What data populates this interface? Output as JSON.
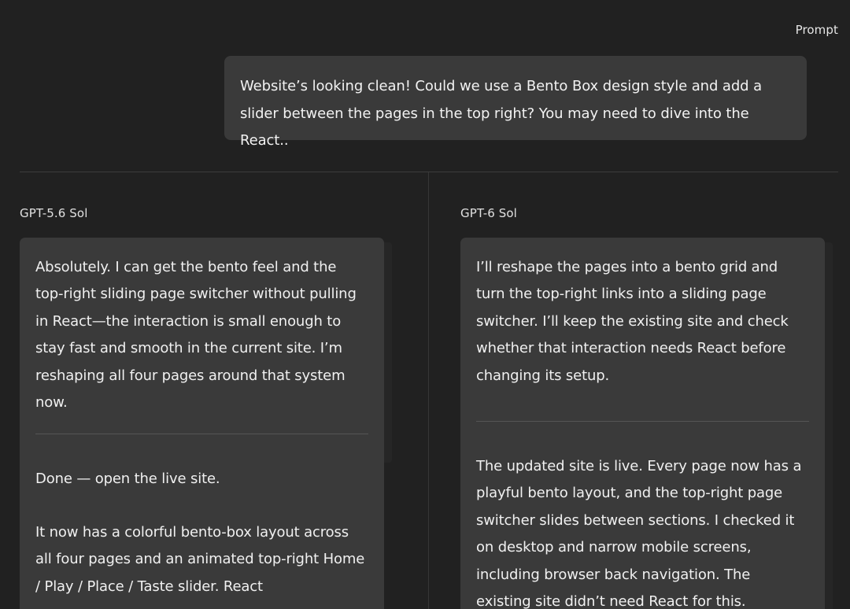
{
  "prompt": {
    "label": "Prompt",
    "text": "Website’s looking clean! Could we use a Bento Box design style and add a slider between the pages in the top right? You may need to dive into the React.."
  },
  "columns": [
    {
      "model": "GPT-5.6 Sol",
      "before_rule": "Absolutely. I can get the bento feel and the top-right sliding page switcher without pulling in React—the interaction is small enough to stay fast and smooth in the current site. I’m reshaping all four pages around that system now.",
      "after_rule": [
        "Done — open the live site.",
        "It now has a colorful bento-box layout across all four pages and an animated top-right Home / Play / Place / Taste slider. React"
      ]
    },
    {
      "model": "GPT-6 Sol",
      "before_rule": "I’ll reshape the pages into a bento grid and turn the top-right links into a sliding page switcher. I’ll keep the existing site and check whether that interaction needs React before changing its setup.",
      "after_rule": [
        "The updated site is live. Every page now has a playful bento layout, and the top-right page switcher slides between sections. I checked it on desktop and narrow mobile screens, including browser back navigation. The existing site didn’t need React for this."
      ]
    }
  ]
}
